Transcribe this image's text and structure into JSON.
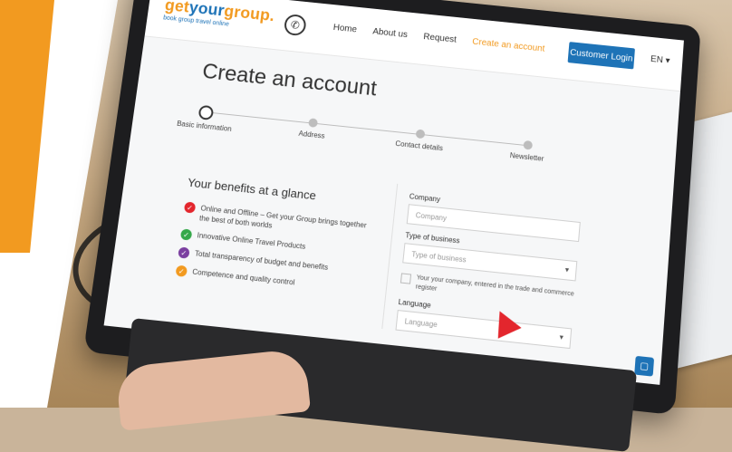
{
  "header": {
    "logo_main_a": "get",
    "logo_main_b": "your",
    "logo_main_c": "group.",
    "logo_tagline": "book group travel online",
    "nav": [
      "Home",
      "About us",
      "Request",
      "Create an account"
    ],
    "login_label": "Customer Login",
    "language": "EN ▾"
  },
  "page": {
    "title": "Create an account",
    "steps": [
      "Basic information",
      "Address",
      "Contact details",
      "Newsletter"
    ],
    "benefits_title": "Your benefits at a glance",
    "benefits": [
      {
        "text": "Online and Offline – Get your Group brings together the best of both worlds",
        "color": "#e3262d"
      },
      {
        "text": "Innovative Online Travel Products",
        "color": "#35a84a"
      },
      {
        "text": "Total transparency of budget and benefits",
        "color": "#7b3fa0"
      },
      {
        "text": "Competence and quality control",
        "color": "#f29a20"
      }
    ],
    "form": {
      "company_label": "Company",
      "company_placeholder": "Company",
      "type_label": "Type of business",
      "type_placeholder": "Type of business",
      "checkbox_text": "Your your company, entered in the trade and commerce register",
      "language_label": "Language",
      "language_placeholder": "Language"
    }
  },
  "colors": {
    "brand_orange": "#f29a20",
    "brand_blue": "#1e73b7",
    "cursor_red": "#e3262d"
  }
}
